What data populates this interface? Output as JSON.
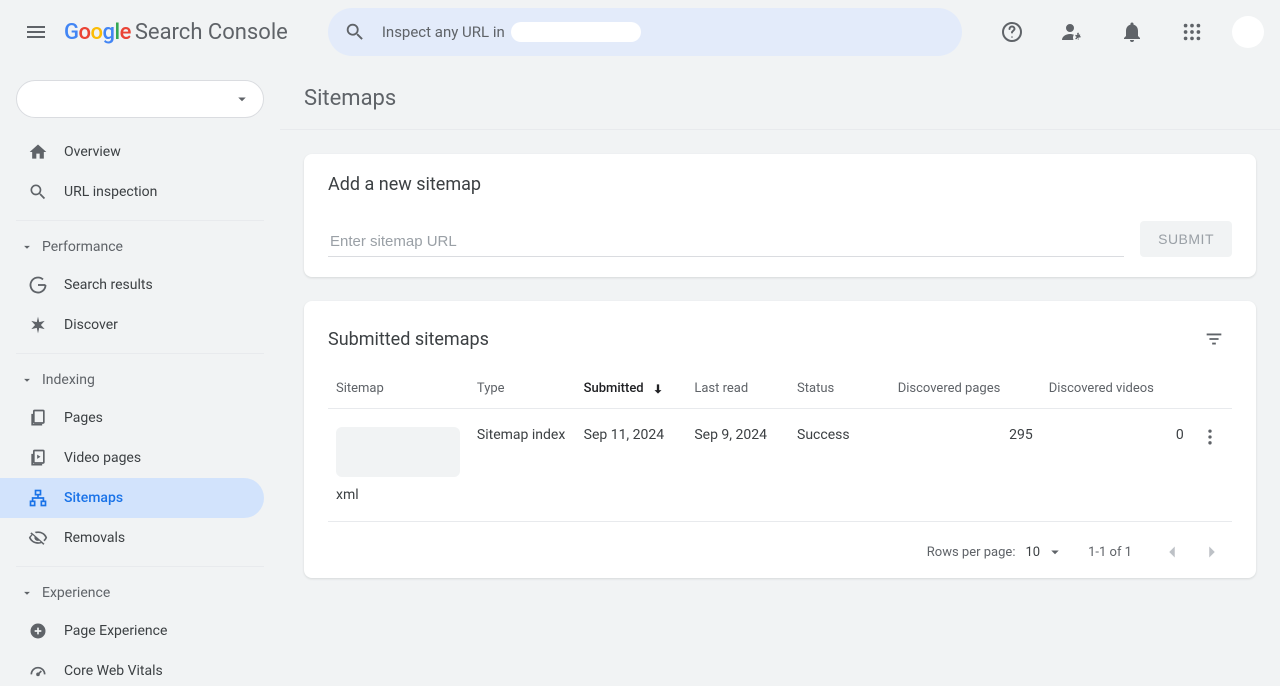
{
  "header": {
    "product_name": "Search Console",
    "search_placeholder_prefix": "Inspect any URL in"
  },
  "sidebar": {
    "groups": [
      {
        "header": null,
        "items": [
          {
            "label": "Overview",
            "icon": "home-icon"
          },
          {
            "label": "URL inspection",
            "icon": "search-icon"
          }
        ]
      },
      {
        "header": "Performance",
        "items": [
          {
            "label": "Search results",
            "icon": "google-g-icon"
          },
          {
            "label": "Discover",
            "icon": "asterisk-icon"
          }
        ]
      },
      {
        "header": "Indexing",
        "items": [
          {
            "label": "Pages",
            "icon": "pages-icon"
          },
          {
            "label": "Video pages",
            "icon": "video-pages-icon"
          },
          {
            "label": "Sitemaps",
            "icon": "sitemap-icon",
            "active": true
          },
          {
            "label": "Removals",
            "icon": "eye-off-icon"
          }
        ]
      },
      {
        "header": "Experience",
        "items": [
          {
            "label": "Page Experience",
            "icon": "plus-circle-icon"
          },
          {
            "label": "Core Web Vitals",
            "icon": "speedometer-icon"
          }
        ]
      }
    ]
  },
  "page": {
    "title": "Sitemaps",
    "add_card": {
      "title": "Add a new sitemap",
      "input_placeholder": "Enter sitemap URL",
      "submit_label": "SUBMIT"
    },
    "list_card": {
      "title": "Submitted sitemaps",
      "columns": {
        "sitemap": "Sitemap",
        "type": "Type",
        "submitted": "Submitted",
        "last_read": "Last read",
        "status": "Status",
        "discovered_pages": "Discovered pages",
        "discovered_videos": "Discovered videos"
      },
      "rows": [
        {
          "sitemap_suffix": "xml",
          "type": "Sitemap index",
          "submitted": "Sep 11, 2024",
          "last_read": "Sep 9, 2024",
          "status": "Success",
          "discovered_pages": "295",
          "discovered_videos": "0"
        }
      ],
      "footer": {
        "rows_per_page_label": "Rows per page:",
        "rows_per_page_value": "10",
        "range_label": "1-1 of 1"
      }
    }
  }
}
